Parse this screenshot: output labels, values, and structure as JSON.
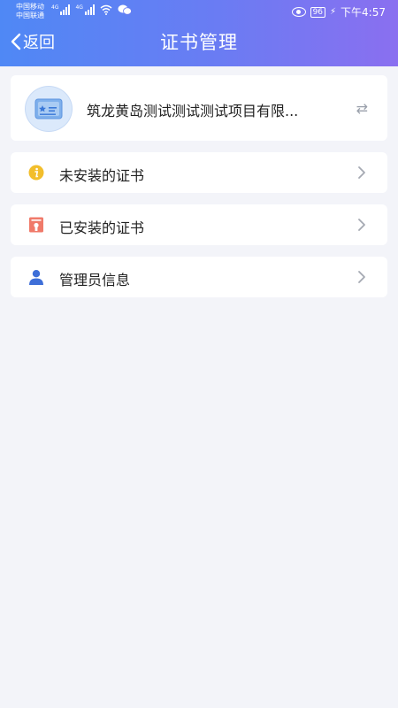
{
  "status_bar": {
    "carrier_1": "中国移动",
    "carrier_2": "中国联通",
    "network_1": "4G",
    "network_2": "4G",
    "battery": "96",
    "time": "下午4:57"
  },
  "header": {
    "back_label": "返回",
    "title": "证书管理",
    "gradient_start": "#4f88f5",
    "gradient_end": "#8a6ff0"
  },
  "company": {
    "name": "筑龙黄岛测试测试测试项目有限...",
    "icon": "certificate-card-icon",
    "switch_icon": "swap-arrows-icon"
  },
  "menu": [
    {
      "label": "未安装的证书",
      "icon": "info-circle-icon",
      "icon_color": "#f2be2c"
    },
    {
      "label": "已安装的证书",
      "icon": "certificate-doc-icon",
      "icon_color": "#f07a6a"
    },
    {
      "label": "管理员信息",
      "icon": "person-icon",
      "icon_color": "#3e6fd8"
    }
  ]
}
